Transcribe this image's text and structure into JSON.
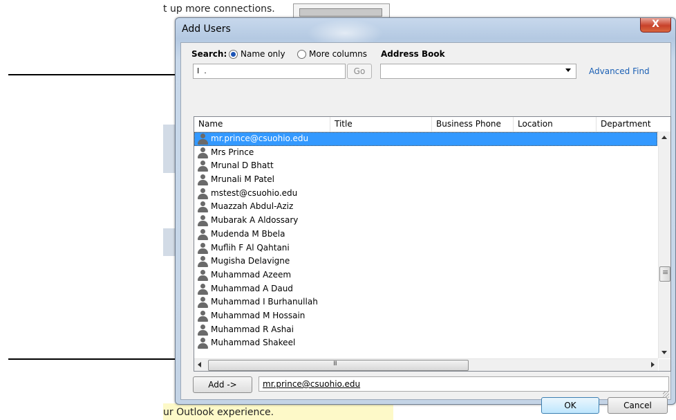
{
  "background": {
    "top_text": "t up more connections.",
    "bottom_text": "ur Outlook experience."
  },
  "dialog": {
    "title": "Add Users",
    "close_glyph": "X",
    "search": {
      "label": "Search:",
      "option_name_only": "Name only",
      "option_more_columns": "More columns",
      "selected_option": "Name only",
      "input_value": "I  .",
      "go_label": "Go"
    },
    "address_book": {
      "label": "Address Book",
      "selected_value": ""
    },
    "advanced_find_label": "Advanced Find",
    "columns": [
      "Name",
      "Title",
      "Business Phone",
      "Location",
      "Department"
    ],
    "rows": [
      "mr.prince@csuohio.edu",
      "Mrs Prince",
      "Mrunal D Bhatt",
      "Mrunali M Patel",
      "mstest@csuohio.edu",
      "Muazzah  Abdul-Aziz",
      "Mubarak A Aldossary",
      "Mudenda M Bbela",
      "Muflih F Al Qahtani",
      "Mugisha  Delavigne",
      "Muhammad  Azeem",
      "Muhammad A Daud",
      "Muhammad I Burhanullah",
      "Muhammad M Hossain",
      "Muhammad R Ashai",
      "Muhammad Shakeel"
    ],
    "selected_row": 0,
    "add_button_label": "Add ->",
    "add_field_value": "mr.prince@csuohio.edu",
    "ok_label": "OK",
    "cancel_label": "Cancel"
  },
  "colors": {
    "selection": "#3399ff",
    "link": "#1a5fb4",
    "close_button": "#c8412a"
  }
}
